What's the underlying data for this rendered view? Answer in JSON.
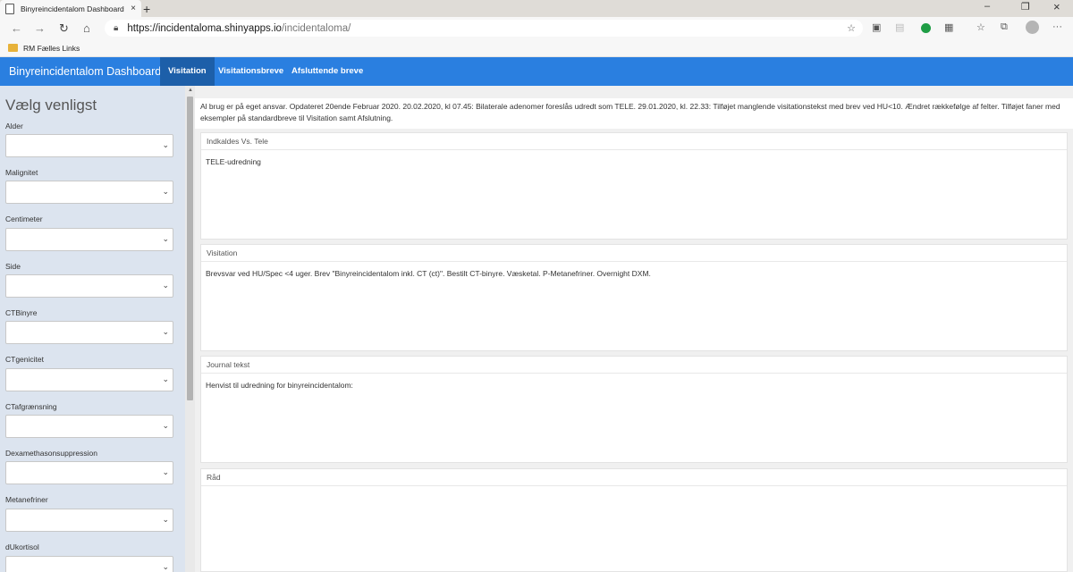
{
  "browser": {
    "tab_title": "Binyreincidentalom Dashboard",
    "tab_close": "×",
    "new_tab": "+",
    "url_host": "https://incidentaloma.shinyapps.io",
    "url_path": "/incidentaloma/",
    "bookmark": "RM Fælles Links",
    "window_controls": {
      "minimize": "–",
      "restore": "❐",
      "close": "×"
    },
    "nav": {
      "back": "←",
      "forward": "→",
      "reload": "↻",
      "home": "⌂",
      "more": "···"
    }
  },
  "navbar": {
    "brand": "Binyreincidentalom Dashboard",
    "tabs": [
      "Visitation",
      "Visitationsbreve",
      "Afsluttende breve"
    ],
    "active_tab": "Visitation"
  },
  "sidebar": {
    "title": "Vælg venligst",
    "fields": [
      {
        "label": "Alder",
        "value": ""
      },
      {
        "label": "Malignitet",
        "value": ""
      },
      {
        "label": "Centimeter",
        "value": ""
      },
      {
        "label": "Side",
        "value": ""
      },
      {
        "label": "CTBinyre",
        "value": ""
      },
      {
        "label": "CTgenicitet",
        "value": ""
      },
      {
        "label": "CTafgrænsning",
        "value": ""
      },
      {
        "label": "Dexamethasonsuppression",
        "value": ""
      },
      {
        "label": "Metanefriner",
        "value": ""
      },
      {
        "label": "dUkortisol",
        "value": ""
      }
    ]
  },
  "main": {
    "info": "Al brug er på eget ansvar. Opdateret 20ende Februar 2020. 20.02.2020, kl 07.45: Bilaterale adenomer foreslås udredt som TELE. 29.01.2020, kl. 22.33: Tilføjet manglende visitationstekst med brev ved HU<10. Ændret rækkefølge af felter. Tilføjet faner med eksempler på standardbreve til Visitation samt Afslutning.",
    "panels": [
      {
        "title": "Indkaldes Vs. Tele",
        "text": "TELE-udredning"
      },
      {
        "title": "Visitation",
        "text": "Brevsvar ved HU/Spec <4 uger. Brev \"Binyreincidentalom inkl. CT (ct)\". Bestilt CT-binyre. Væsketal. P-Metanefriner. Overnight DXM."
      },
      {
        "title": "Journal tekst",
        "text": "Henvist til udredning for binyreincidentalom:"
      },
      {
        "title": "Råd",
        "text": ""
      }
    ]
  }
}
